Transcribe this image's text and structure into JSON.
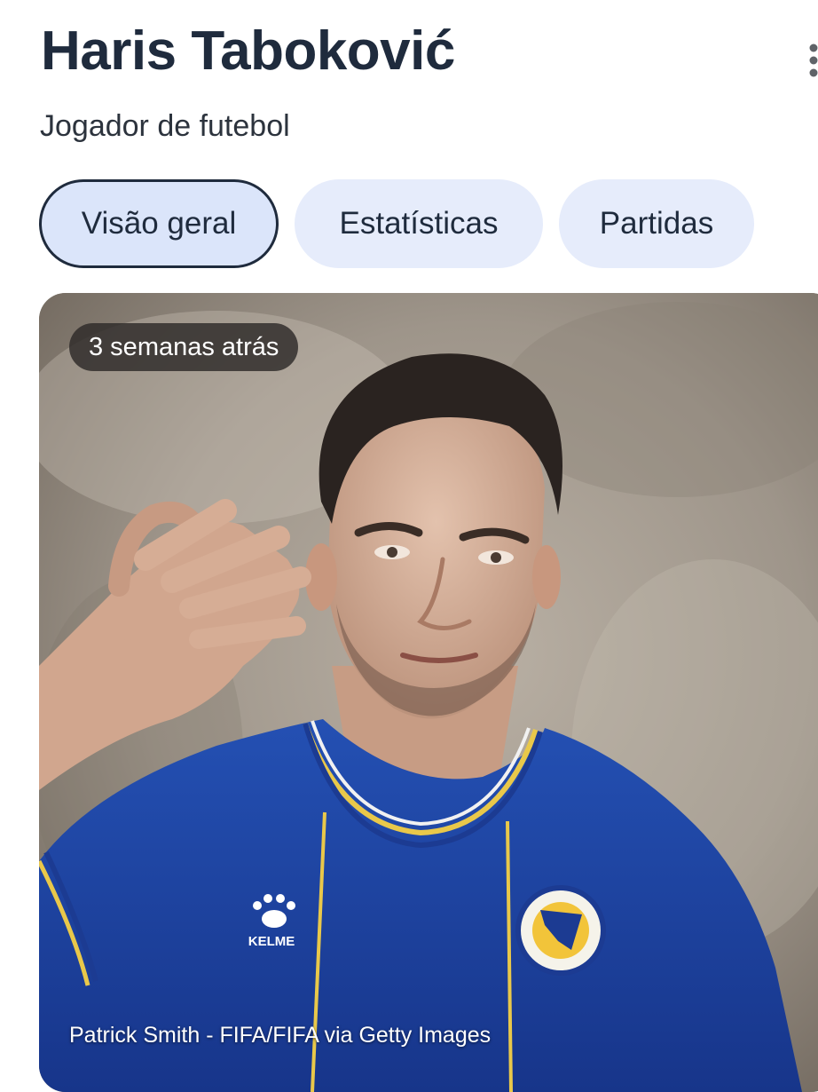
{
  "header": {
    "title": "Haris Taboković",
    "subtitle": "Jogador de futebol",
    "menu_icon": "more-vertical-icon"
  },
  "tabs": [
    {
      "label": "Visão geral",
      "active": true
    },
    {
      "label": "Estatísticas",
      "active": false
    },
    {
      "label": "Partidas",
      "active": false
    }
  ],
  "photo": {
    "timestamp": "3 semanas atrás",
    "credit": "Patrick Smith - FIFA/FIFA via Getty Images",
    "shirt_brand": "KELME"
  },
  "colors": {
    "title_text": "#1f2b3d",
    "tab_background": "#e6ecfb",
    "active_tab_border": "#1f2b3d",
    "jersey_blue": "#1d3f9a",
    "jersey_trim": "#e9c84a"
  }
}
